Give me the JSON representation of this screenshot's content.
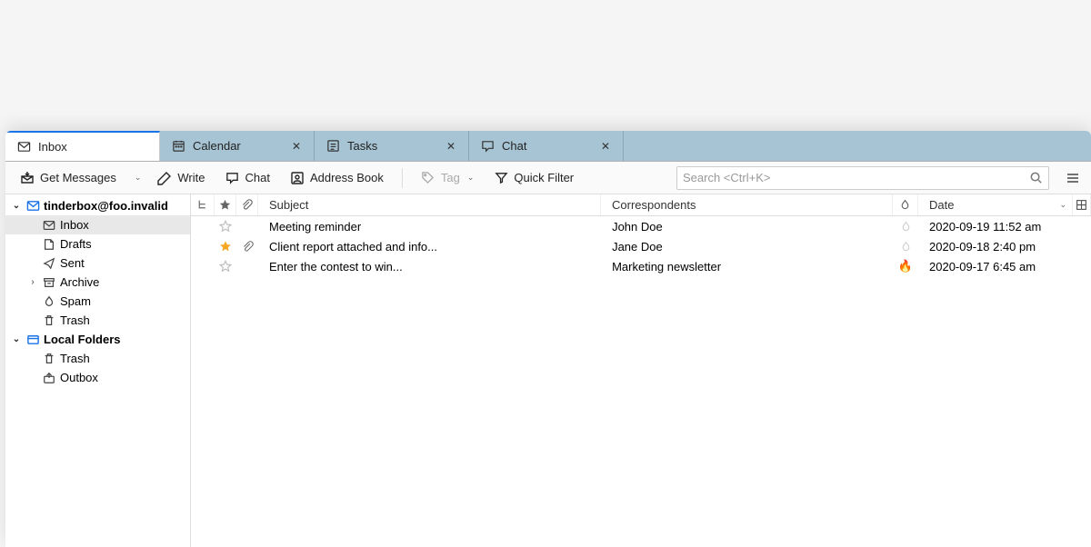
{
  "tabs": [
    {
      "label": "Inbox",
      "active": true
    },
    {
      "label": "Calendar",
      "closable": true
    },
    {
      "label": "Tasks",
      "closable": true
    },
    {
      "label": "Chat",
      "closable": true
    }
  ],
  "toolbar": {
    "get_messages": "Get Messages",
    "write": "Write",
    "chat": "Chat",
    "address_book": "Address Book",
    "tag": "Tag",
    "quick_filter": "Quick Filter",
    "search_placeholder": "Search <Ctrl+K>"
  },
  "sidebar": {
    "accounts": [
      {
        "name": "tinderbox@foo.invalid",
        "expanded": true,
        "folders": [
          {
            "name": "Inbox",
            "icon": "inbox",
            "selected": true
          },
          {
            "name": "Drafts",
            "icon": "drafts"
          },
          {
            "name": "Sent",
            "icon": "sent"
          },
          {
            "name": "Archive",
            "icon": "archive",
            "has_children": true
          },
          {
            "name": "Spam",
            "icon": "spam"
          },
          {
            "name": "Trash",
            "icon": "trash"
          }
        ]
      },
      {
        "name": "Local Folders",
        "expanded": true,
        "folders": [
          {
            "name": "Trash",
            "icon": "trash"
          },
          {
            "name": "Outbox",
            "icon": "outbox"
          }
        ]
      }
    ]
  },
  "columns": {
    "subject": "Subject",
    "correspondents": "Correspondents",
    "date": "Date"
  },
  "messages": [
    {
      "starred": false,
      "attachment": false,
      "subject": "Meeting reminder",
      "correspondent": "John Doe",
      "hot": false,
      "date": "2020-09-19 11:52 am"
    },
    {
      "starred": true,
      "attachment": true,
      "subject": "Client report attached and info...",
      "correspondent": "Jane Doe",
      "hot": false,
      "date": "2020-09-18 2:40 pm"
    },
    {
      "starred": false,
      "attachment": false,
      "subject": "Enter the contest to win...",
      "correspondent": "Marketing newsletter",
      "hot": true,
      "date": "2020-09-17 6:45 am"
    }
  ]
}
